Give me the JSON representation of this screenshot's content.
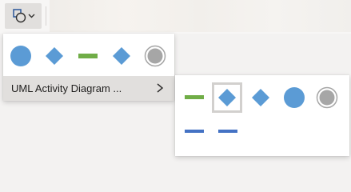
{
  "toolbar": {
    "shapes_button_icon": "shapes-icon",
    "dropdown_arrow_icon": "chevron-down-icon"
  },
  "dropdown": {
    "shapes": [
      {
        "name": "circle",
        "color": "#5b9bd5"
      },
      {
        "name": "diamond",
        "color": "#5b9bd5"
      },
      {
        "name": "bar",
        "color": "#70ad47"
      },
      {
        "name": "diamond",
        "color": "#5b9bd5"
      },
      {
        "name": "final-node",
        "color": "#a6a6a6"
      }
    ],
    "submenu_label": "UML Activity Diagram ...",
    "submenu_icon": "chevron-right-icon"
  },
  "flyout": {
    "shapes": [
      {
        "name": "bar",
        "color": "#70ad47"
      },
      {
        "name": "diamond",
        "color": "#5b9bd5",
        "selected": true
      },
      {
        "name": "diamond",
        "color": "#5b9bd5"
      },
      {
        "name": "circle",
        "color": "#5b9bd5"
      },
      {
        "name": "final-node",
        "color": "#a6a6a6"
      },
      {
        "name": "bar",
        "color": "#4472c4"
      },
      {
        "name": "bar",
        "color": "#4472c4"
      }
    ]
  }
}
